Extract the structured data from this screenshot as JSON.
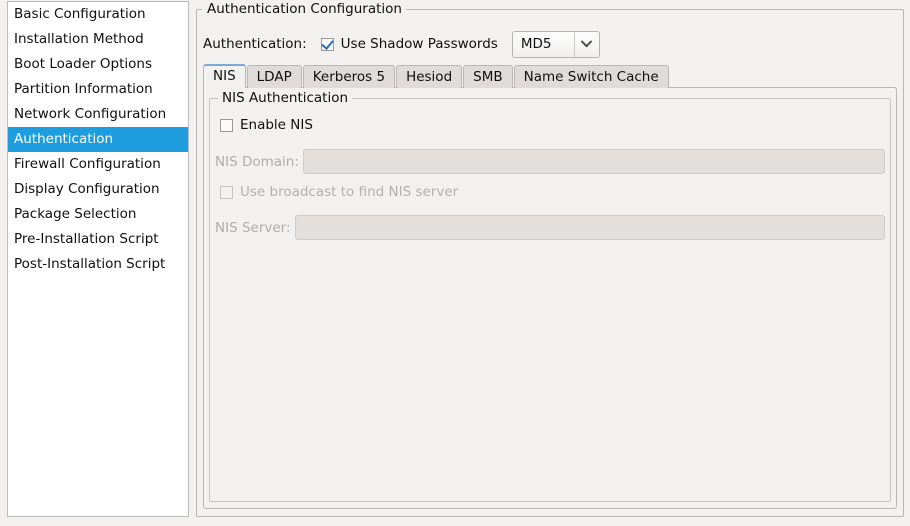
{
  "sidebar": {
    "items": [
      {
        "label": "Basic Configuration",
        "selected": false
      },
      {
        "label": "Installation Method",
        "selected": false
      },
      {
        "label": "Boot Loader Options",
        "selected": false
      },
      {
        "label": "Partition Information",
        "selected": false
      },
      {
        "label": "Network Configuration",
        "selected": false
      },
      {
        "label": "Authentication",
        "selected": true
      },
      {
        "label": "Firewall Configuration",
        "selected": false
      },
      {
        "label": "Display Configuration",
        "selected": false
      },
      {
        "label": "Package Selection",
        "selected": false
      },
      {
        "label": "Pre-Installation Script",
        "selected": false
      },
      {
        "label": "Post-Installation Script",
        "selected": false
      }
    ],
    "selected_index": 5
  },
  "auth_group": {
    "title": "Authentication Configuration",
    "auth_label": "Authentication:",
    "shadow_passwords": {
      "label": "Use Shadow Passwords",
      "checked": true
    },
    "hash_combo": {
      "value": "MD5",
      "arrow_icon": "chevron-down-icon"
    }
  },
  "tabs": [
    {
      "label": "NIS",
      "active": true
    },
    {
      "label": "LDAP",
      "active": false
    },
    {
      "label": "Kerberos 5",
      "active": false
    },
    {
      "label": "Hesiod",
      "active": false
    },
    {
      "label": "SMB",
      "active": false
    },
    {
      "label": "Name Switch Cache",
      "active": false
    }
  ],
  "nis_panel": {
    "group_title": "NIS Authentication",
    "enable_nis": {
      "label": "Enable NIS",
      "checked": false,
      "disabled": false
    },
    "nis_domain": {
      "label": "NIS Domain:",
      "value": "",
      "disabled": true
    },
    "use_broadcast": {
      "label": "Use broadcast to find NIS server",
      "checked": false,
      "disabled": true
    },
    "nis_server": {
      "label": "NIS Server:",
      "value": "",
      "disabled": true
    }
  },
  "colors": {
    "selection_blue": "#1d9dde",
    "window_bg": "#f2f1f0",
    "list_bg": "#ffffff",
    "frame_border": "#b9b6b4",
    "tab_inactive_bg": "#dedbd9",
    "active_tab_top": "#7aa8d8",
    "disabled_text": "#b0adab",
    "entry_disabled_bg": "#e2dfdd",
    "check_blue": "#2a6ec0"
  }
}
